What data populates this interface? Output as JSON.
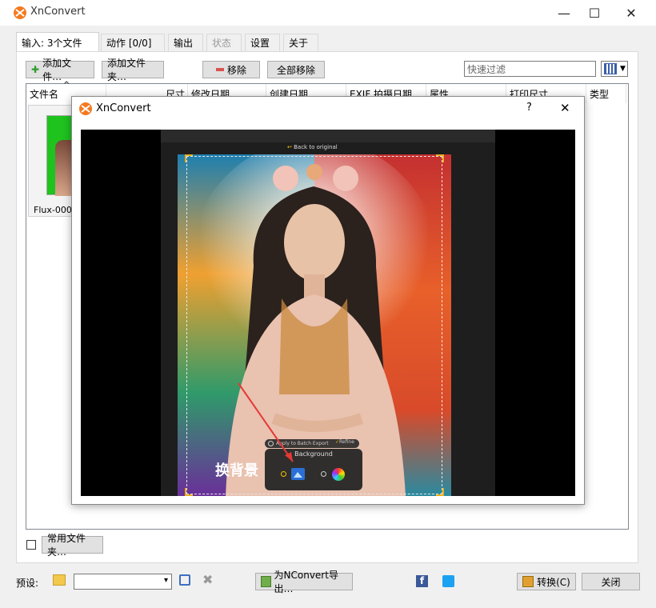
{
  "window": {
    "title": "XnConvert",
    "minimize": "—",
    "maximize": "☐",
    "close": "✕"
  },
  "tabs": [
    {
      "label": "输入: 3个文件"
    },
    {
      "label": "动作 [0/0]"
    },
    {
      "label": "输出"
    },
    {
      "label": "状态"
    },
    {
      "label": "设置"
    },
    {
      "label": "关于"
    }
  ],
  "toolbar": {
    "add_files": "添加文件…",
    "add_folder": "添加文件夹…",
    "remove": "移除",
    "remove_all": "全部移除",
    "filter_placeholder": "快速过滤"
  },
  "columns": [
    "文件名",
    "尺寸",
    "修改日期",
    "创建日期",
    "EXIF 拍摄日期",
    "属性",
    "打印尺寸",
    "类型"
  ],
  "files": [
    {
      "name": "Flux-000"
    }
  ],
  "dialog": {
    "title": "XnConvert",
    "help": "?",
    "close": "✕",
    "back_label": "Back to original",
    "apply_label": "Apply to Batch Export",
    "bg_panel_title": "Background",
    "annotation": "换背景",
    "refine_label": "Refine"
  },
  "footer": {
    "common_folders": "常用文件夹…",
    "preset_label": "预设:",
    "export_button": "为NConvert导出…",
    "convert_button": "转换(C)",
    "close_button": "关闭"
  },
  "colors": {
    "accent": "#f47a20",
    "facebook": "#3b5998",
    "twitter": "#1da1f2",
    "annotation": "#e53935"
  }
}
